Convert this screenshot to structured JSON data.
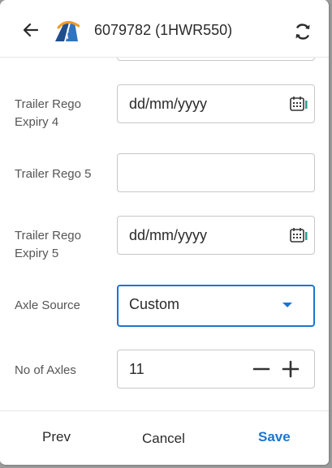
{
  "header": {
    "title": "6079782 (1HWR550)",
    "back_icon": "arrow-left-icon",
    "logo_icon": "road-logo-icon",
    "sync_icon": "sync-icon"
  },
  "form": {
    "trailer_rego_expiry_4": {
      "label": "Trailer Rego Expiry 4",
      "placeholder": "dd/mm/yyyy"
    },
    "trailer_rego_5": {
      "label": "Trailer Rego 5",
      "value": ""
    },
    "trailer_rego_expiry_5": {
      "label": "Trailer Rego Expiry 5",
      "placeholder": "dd/mm/yyyy"
    },
    "axle_source": {
      "label": "Axle Source",
      "value": "Custom"
    },
    "no_of_axles": {
      "label": "No of Axles",
      "value": "11"
    }
  },
  "footer": {
    "prev": "Prev",
    "cancel": "Cancel",
    "save": "Save"
  },
  "colors": {
    "accent": "#1b75d0",
    "border": "#c8c8c8",
    "text": "#2a2a2a"
  }
}
